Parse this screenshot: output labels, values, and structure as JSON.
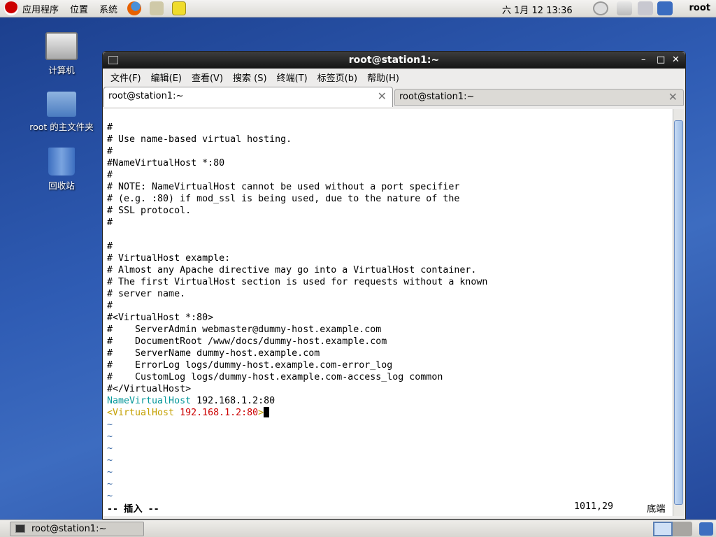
{
  "top_panel": {
    "menus": [
      "应用程序",
      "位置",
      "系统"
    ],
    "clock": "六 1月 12 13:36",
    "user": "root",
    "icons": [
      "redhat-logo-icon",
      "firefox-icon",
      "mail-icon",
      "notes-icon",
      "gauge-icon",
      "network-keyboard-icon",
      "volume-icon",
      "network-icon"
    ]
  },
  "desktop": {
    "icons": [
      {
        "label": "计算机",
        "icon": "computer-icon"
      },
      {
        "label": "root 的主文件夹",
        "icon": "home-folder-icon"
      },
      {
        "label": "回收站",
        "icon": "trash-icon"
      }
    ]
  },
  "window": {
    "title": "root@station1:~",
    "menu": [
      "文件(F)",
      "编辑(E)",
      "查看(V)",
      "搜索 (S)",
      "终端(T)",
      "标签页(b)",
      "帮助(H)"
    ],
    "tabs": [
      {
        "label": "root@station1:~",
        "active": true
      },
      {
        "label": "root@station1:~",
        "active": false
      }
    ],
    "lines": [
      "#",
      "# Use name-based virtual hosting.",
      "#",
      "#NameVirtualHost *:80",
      "#",
      "# NOTE: NameVirtualHost cannot be used without a port specifier",
      "# (e.g. :80) if mod_ssl is being used, due to the nature of the",
      "# SSL protocol.",
      "#",
      "",
      "#",
      "# VirtualHost example:",
      "# Almost any Apache directive may go into a VirtualHost container.",
      "# The first VirtualHost section is used for requests without a known",
      "# server name.",
      "#",
      "#<VirtualHost *:80>",
      "#    ServerAdmin webmaster@dummy-host.example.com",
      "#    DocumentRoot /www/docs/dummy-host.example.com",
      "#    ServerName dummy-host.example.com",
      "#    ErrorLog logs/dummy-host.example.com-error_log",
      "#    CustomLog logs/dummy-host.example.com-access_log common",
      "#</VirtualHost>"
    ],
    "line_nvh": {
      "keyword": "NameVirtualHost",
      "value": " 192.168.1.2:80"
    },
    "line_vh": {
      "open": "<VirtualHost",
      "value": " 192.168.1.2:80",
      "close": ">"
    },
    "tilde": "~",
    "status": {
      "mode": "-- 插入 --",
      "position": "1011,29",
      "scroll": "底端"
    },
    "colors": {
      "keyword": "#06989a",
      "tag": "#c4a000",
      "value": "#cc0000",
      "tilde": "#3465a4"
    }
  },
  "bottom_panel": {
    "task": "root@station1:~"
  }
}
